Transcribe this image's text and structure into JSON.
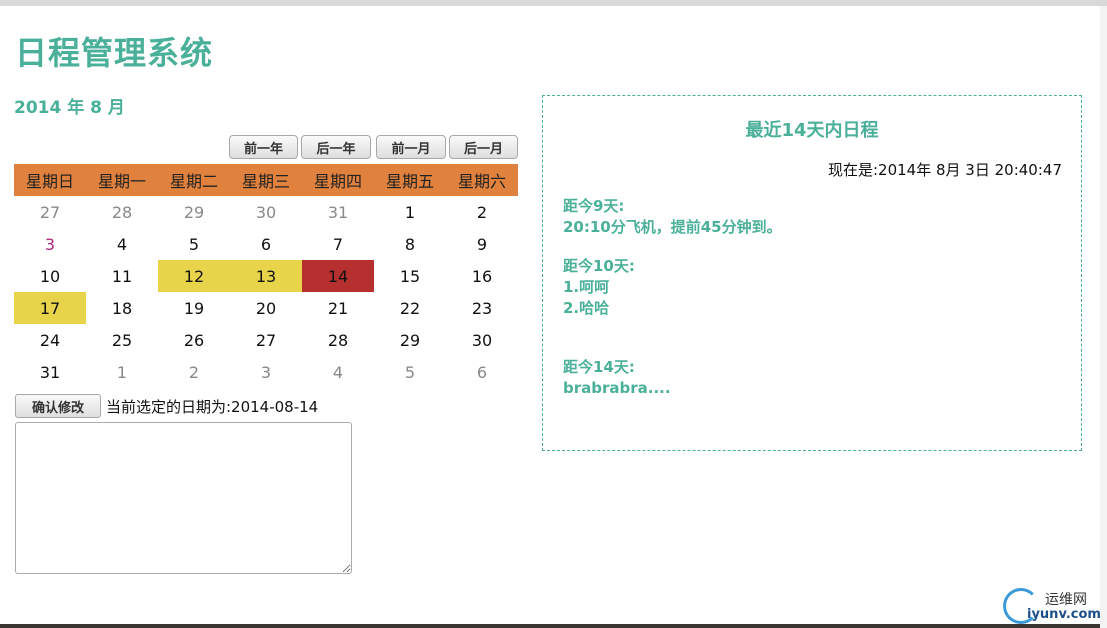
{
  "app": {
    "title": "日程管理系统"
  },
  "calendar": {
    "month_title": "2014 年 8 月",
    "nav": {
      "prev_year": "前一年",
      "next_year": "后一年",
      "prev_month": "前一月",
      "next_month": "后一月"
    },
    "weekdays": [
      "星期日",
      "星期一",
      "星期二",
      "星期三",
      "星期四",
      "星期五",
      "星期六"
    ],
    "weeks": [
      [
        {
          "day": "27",
          "state": "other"
        },
        {
          "day": "28",
          "state": "other"
        },
        {
          "day": "29",
          "state": "other"
        },
        {
          "day": "30",
          "state": "other"
        },
        {
          "day": "31",
          "state": "other"
        },
        {
          "day": "1",
          "state": "normal"
        },
        {
          "day": "2",
          "state": "normal"
        }
      ],
      [
        {
          "day": "3",
          "state": "today"
        },
        {
          "day": "4",
          "state": "normal"
        },
        {
          "day": "5",
          "state": "normal"
        },
        {
          "day": "6",
          "state": "normal"
        },
        {
          "day": "7",
          "state": "normal"
        },
        {
          "day": "8",
          "state": "normal"
        },
        {
          "day": "9",
          "state": "normal"
        }
      ],
      [
        {
          "day": "10",
          "state": "normal"
        },
        {
          "day": "11",
          "state": "normal"
        },
        {
          "day": "12",
          "state": "scheduled"
        },
        {
          "day": "13",
          "state": "scheduled"
        },
        {
          "day": "14",
          "state": "selected"
        },
        {
          "day": "15",
          "state": "normal"
        },
        {
          "day": "16",
          "state": "normal"
        }
      ],
      [
        {
          "day": "17",
          "state": "scheduled"
        },
        {
          "day": "18",
          "state": "normal"
        },
        {
          "day": "19",
          "state": "normal"
        },
        {
          "day": "20",
          "state": "normal"
        },
        {
          "day": "21",
          "state": "normal"
        },
        {
          "day": "22",
          "state": "normal"
        },
        {
          "day": "23",
          "state": "normal"
        }
      ],
      [
        {
          "day": "24",
          "state": "normal"
        },
        {
          "day": "25",
          "state": "normal"
        },
        {
          "day": "26",
          "state": "normal"
        },
        {
          "day": "27",
          "state": "normal"
        },
        {
          "day": "28",
          "state": "normal"
        },
        {
          "day": "29",
          "state": "normal"
        },
        {
          "day": "30",
          "state": "normal"
        }
      ],
      [
        {
          "day": "31",
          "state": "normal"
        },
        {
          "day": "1",
          "state": "other"
        },
        {
          "day": "2",
          "state": "other"
        },
        {
          "day": "3",
          "state": "other"
        },
        {
          "day": "4",
          "state": "other"
        },
        {
          "day": "5",
          "state": "other"
        },
        {
          "day": "6",
          "state": "other"
        }
      ]
    ],
    "colors": {
      "header_bg": "#e0823d",
      "scheduled_bg": "#e8d44a",
      "selected_bg": "#b5302e",
      "today_text": "#b0297a"
    }
  },
  "editor": {
    "confirm_label": "确认修改",
    "selected_date_text": "当前选定的日期为:2014-08-14",
    "textarea_value": ""
  },
  "schedule_panel": {
    "title": "最近14天内日程",
    "now_text": "现在是:2014年 8月 3日 20:40:47",
    "entries": [
      {
        "heading": "距今9天:",
        "lines": [
          "20:10分飞机，提前45分钟到。"
        ]
      },
      {
        "heading": "距今10天:",
        "lines": [
          "1.呵呵",
          "2.哈哈"
        ]
      },
      {
        "heading": "距今14天:",
        "lines": [
          "brabrabra...."
        ]
      }
    ]
  },
  "watermark": {
    "cn": "运维网",
    "en": "iyunv.com"
  },
  "theme": {
    "accent": "#4bb09a"
  }
}
